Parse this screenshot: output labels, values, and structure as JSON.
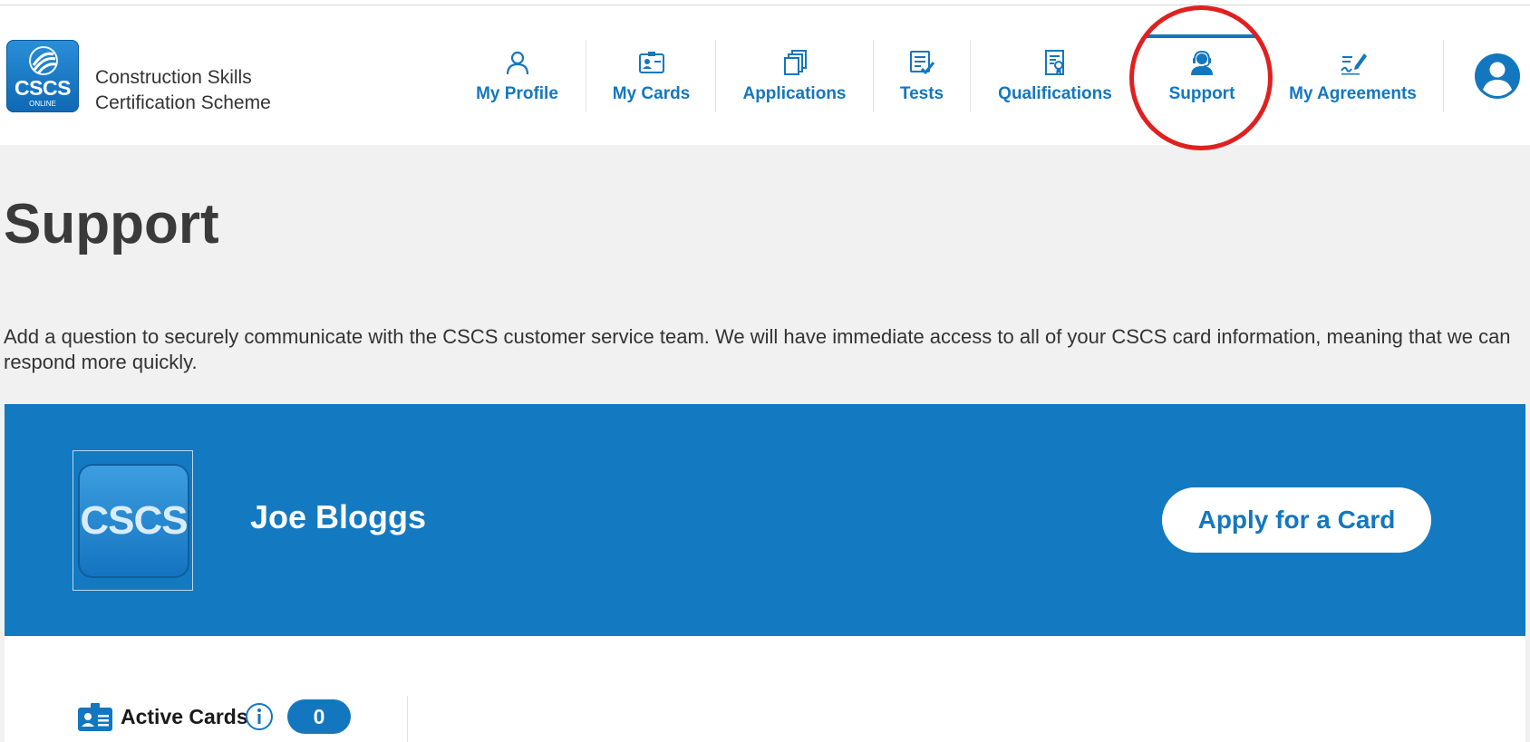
{
  "brand": {
    "logo_text": "CSCS",
    "logo_sub": "ONLINE",
    "name": "Construction Skills Certification Scheme"
  },
  "nav": {
    "items": [
      {
        "label": "My Profile",
        "icon": "person-outline-icon"
      },
      {
        "label": "My Cards",
        "icon": "id-card-icon"
      },
      {
        "label": "Applications",
        "icon": "stacked-documents-icon"
      },
      {
        "label": "Tests",
        "icon": "checklist-icon"
      },
      {
        "label": "Qualifications",
        "icon": "certificate-document-icon"
      },
      {
        "label": "Support",
        "icon": "headset-agent-icon",
        "active": true
      },
      {
        "label": "My Agreements",
        "icon": "signature-pen-icon"
      }
    ],
    "account_icon": "user-account-icon"
  },
  "page": {
    "title": "Support",
    "intro": "Add a question to securely communicate with the CSCS customer service team. We will have immediate access to all of your CSCS card information, meaning that we can respond more quickly."
  },
  "banner": {
    "avatar_text": "CSCS",
    "user_name": "Joe Bloggs",
    "apply_button": "Apply for a Card"
  },
  "cards_summary": {
    "label": "Active Cards",
    "count": "0"
  },
  "colors": {
    "accent": "#1377bf",
    "banner": "#1379c1",
    "highlight": "#e02020",
    "background": "#f1f1f1"
  }
}
